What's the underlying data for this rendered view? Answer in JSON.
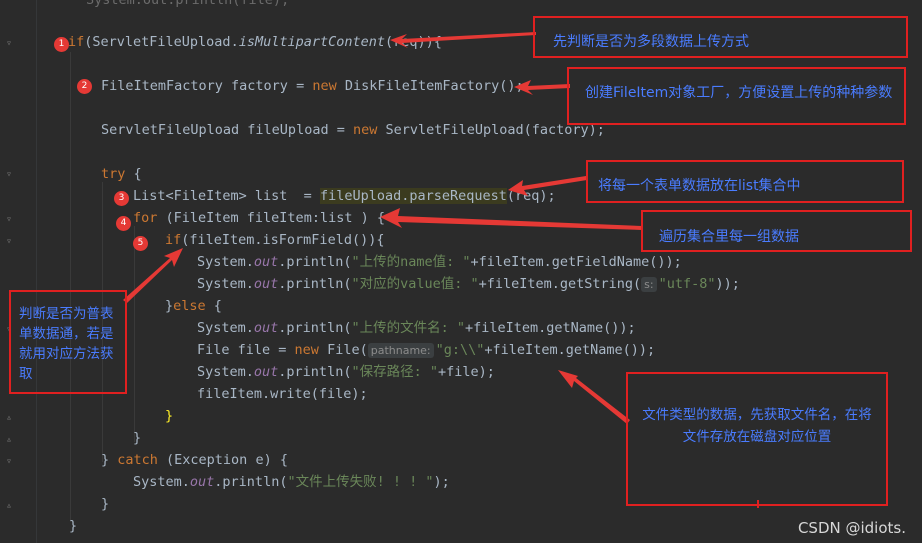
{
  "code": {
    "l0": "System.out.println(file);",
    "l1_kw": "if",
    "l1_a": "(ServletFileUpload.",
    "l1_fn": "isMultipartContent",
    "l1_b": "(req)){",
    "l2_a": "FileItemFactory factory = ",
    "l2_kw": "new",
    "l2_b": " DiskFileItemFactory();",
    "l3_a": "ServletFileUpload fileUpload = ",
    "l3_kw": "new",
    "l3_b": " ServletFileUpload(factory);",
    "l4_kw": "try",
    "l4_b": " {",
    "l5_a": "List<FileItem> list  = ",
    "l5_hl": "fileUpload.parseRequest",
    "l5_b": "(req);",
    "l6_kw": "for",
    "l6_b": " (FileItem fileItem:list ) {",
    "l7_kw": "if",
    "l7_b": "(fileItem.isFormField()){",
    "l8_a": "System.",
    "l8_out": "out",
    "l8_b": ".println(",
    "l8_str": "\"上传的name值: \"",
    "l8_c": "+fileItem.getFieldName());",
    "l9_a": "System.",
    "l9_out": "out",
    "l9_b": ".println(",
    "l9_str": "\"对应的value值: \"",
    "l9_c": "+fileItem.getString(",
    "l9_hint": "s:",
    "l9_str2": "\"utf-8\"",
    "l9_d": "));",
    "l10_a": "}",
    "l10_kw": "else",
    "l10_b": " {",
    "l11_a": "System.",
    "l11_out": "out",
    "l11_b": ".println(",
    "l11_str": "\"上传的文件名: \"",
    "l11_c": "+fileItem.getName());",
    "l12_a": "File file = ",
    "l12_kw": "new",
    "l12_b": " File(",
    "l12_hint": "pathname:",
    "l12_str": "\"g:\\\\\"",
    "l12_c": "+fileItem.getName());",
    "l13_a": "System.",
    "l13_out": "out",
    "l13_b": ".println(",
    "l13_str": "\"保存路径: \"",
    "l13_c": "+file);",
    "l14_a": "fileItem.write(file);",
    "l15": "}",
    "l16": "}",
    "l17_a": "} ",
    "l17_kw": "catch",
    "l17_b": " (Exception e) {",
    "l18_a": "System.",
    "l18_out": "out",
    "l18_b": ".println(",
    "l18_str": "\"文件上传失败! ! ! \"",
    "l18_c": ");",
    "l19": "}",
    "l20": "}"
  },
  "markers": [
    "1",
    "2",
    "3",
    "4",
    "5"
  ],
  "notes": {
    "n1": "先判断是否为多段数据上传方式",
    "n2": "创建FileItem对象工厂，方便设置上传的种种参数",
    "n3": "将每一个表单数据放在list集合中",
    "n4": "遍历集合里每一组数据",
    "n5": "判断是否为普表单数据通，若是就用对应方法获取",
    "n6": "文件类型的数据，先获取文件名，在将文件存放在磁盘对应位置"
  },
  "watermark": "CSDN @idiots.",
  "colors": {
    "background": "#2b2b2b",
    "keyword": "#cc7832",
    "function": "#ffc66d",
    "string": "#6a8759",
    "static_field": "#9876aa",
    "annotation_border": "#e02020",
    "annotation_text": "#4a7cff",
    "marker": "#e53935"
  }
}
